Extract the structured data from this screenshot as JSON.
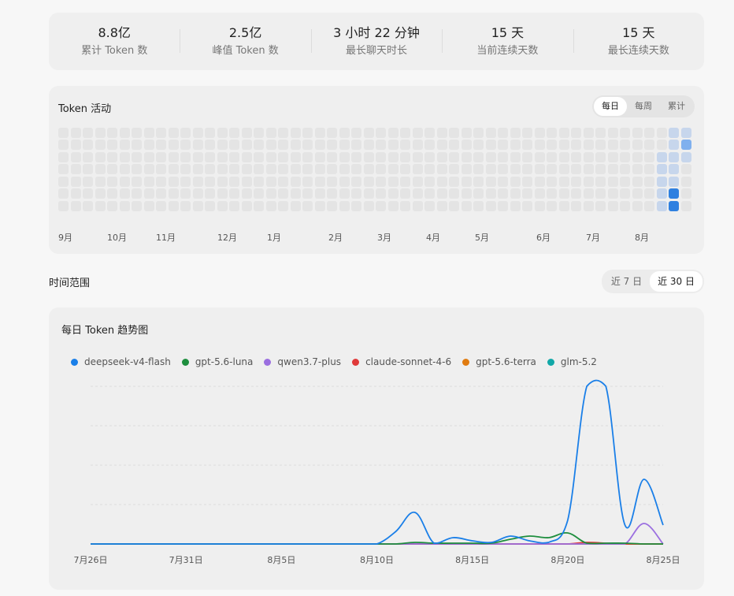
{
  "stats": [
    {
      "value": "8.8亿",
      "label": "累计 Token 数"
    },
    {
      "value": "2.5亿",
      "label": "峰值 Token 数"
    },
    {
      "value": "3 小时 22 分钟",
      "label": "最长聊天时长"
    },
    {
      "value": "15 天",
      "label": "当前连续天数"
    },
    {
      "value": "15 天",
      "label": "最长连续天数"
    }
  ],
  "activity": {
    "title": "Token 活动",
    "tabs": [
      "每日",
      "每周",
      "累计"
    ],
    "active_tab": "每日",
    "months": [
      "9月",
      "10月",
      "11月",
      "12月",
      "1月",
      "2月",
      "3月",
      "4月",
      "5月",
      "6月",
      "7月",
      "8月"
    ],
    "heat_colors": {
      "empty": "#e4e4e4",
      "l1": "#c7d6ec",
      "l2": "#a8c7ee",
      "l3": "#7fb0ee",
      "l4": "#2f80e0"
    },
    "recent_cells": [
      {
        "week_from_end": 1,
        "day": 0,
        "level": 1
      },
      {
        "week_from_end": 1,
        "day": 1,
        "level": 1
      },
      {
        "week_from_end": 1,
        "day": 2,
        "level": 1
      },
      {
        "week_from_end": 1,
        "day": 3,
        "level": 1
      },
      {
        "week_from_end": 1,
        "day": 4,
        "level": 1
      },
      {
        "week_from_end": 1,
        "day": 5,
        "level": 4
      },
      {
        "week_from_end": 1,
        "day": 6,
        "level": 4
      },
      {
        "week_from_end": 0,
        "day": 0,
        "level": 1
      },
      {
        "week_from_end": 0,
        "day": 1,
        "level": 3
      },
      {
        "week_from_end": 0,
        "day": 2,
        "level": 1
      },
      {
        "week_from_end": 2,
        "day": 2,
        "level": 1
      },
      {
        "week_from_end": 2,
        "day": 3,
        "level": 1
      },
      {
        "week_from_end": 2,
        "day": 4,
        "level": 1
      },
      {
        "week_from_end": 2,
        "day": 5,
        "level": 1
      },
      {
        "week_from_end": 2,
        "day": 6,
        "level": 1
      }
    ]
  },
  "range": {
    "label": "时间范围",
    "options": [
      "近 7 日",
      "近 30 日"
    ],
    "active": "近 30 日"
  },
  "trend": {
    "title": "每日 Token 趋势图"
  },
  "chart_data": {
    "type": "line",
    "x": [
      "7月26日",
      "7月27日",
      "7月28日",
      "7月29日",
      "7月30日",
      "7月31日",
      "8月1日",
      "8月2日",
      "8月3日",
      "8月4日",
      "8月5日",
      "8月6日",
      "8月7日",
      "8月8日",
      "8月9日",
      "8月10日",
      "8月11日",
      "8月12日",
      "8月13日",
      "8月14日",
      "8月15日",
      "8月16日",
      "8月17日",
      "8月18日",
      "8月19日",
      "8月20日",
      "8月21日",
      "8月22日",
      "8月23日",
      "8月24日",
      "8月25日"
    ],
    "x_ticks": [
      "7月26日",
      "7月31日",
      "8月5日",
      "8月10日",
      "8月15日",
      "8月20日",
      "8月25日"
    ],
    "ylim": [
      0,
      1
    ],
    "grid": true,
    "legend": "top-left",
    "series": [
      {
        "name": "deepseek-v4-flash",
        "color": "#1a7fe8",
        "values": [
          0,
          0,
          0,
          0,
          0,
          0,
          0,
          0,
          0,
          0,
          0,
          0,
          0,
          0,
          0,
          0,
          0.08,
          0.2,
          0.005,
          0.04,
          0.02,
          0.01,
          0.05,
          0.02,
          0.01,
          0.15,
          1.0,
          1.0,
          0.12,
          0.41,
          0.12
        ]
      },
      {
        "name": "gpt-5.6-luna",
        "color": "#1e8e3e",
        "values": [
          0,
          0,
          0,
          0,
          0,
          0,
          0,
          0,
          0,
          0,
          0,
          0,
          0,
          0,
          0,
          0,
          0,
          0.01,
          0.005,
          0.005,
          0.005,
          0.005,
          0.03,
          0.05,
          0.04,
          0.07,
          0.005,
          0.005,
          0.005,
          0,
          0
        ]
      },
      {
        "name": "qwen3.7-plus",
        "color": "#9b6fe0",
        "values": [
          0,
          0,
          0,
          0,
          0,
          0,
          0,
          0,
          0,
          0,
          0,
          0,
          0,
          0,
          0,
          0,
          0,
          0,
          0,
          0,
          0,
          0,
          0,
          0,
          0,
          0,
          0,
          0,
          0,
          0.13,
          0
        ]
      },
      {
        "name": "claude-sonnet-4-6",
        "color": "#e03a3a",
        "values": [
          0,
          0,
          0,
          0,
          0,
          0,
          0,
          0,
          0,
          0,
          0,
          0,
          0,
          0,
          0,
          0,
          0,
          0,
          0,
          0,
          0,
          0,
          0,
          0,
          0,
          0,
          0.01,
          0.005,
          0,
          0,
          0
        ]
      },
      {
        "name": "gpt-5.6-terra",
        "color": "#e07b10",
        "values": [
          0,
          0,
          0,
          0,
          0,
          0,
          0,
          0,
          0,
          0,
          0,
          0,
          0,
          0,
          0,
          0,
          0,
          0,
          0,
          0,
          0,
          0,
          0,
          0,
          0,
          0,
          0,
          0,
          0,
          0,
          0
        ]
      },
      {
        "name": "glm-5.2",
        "color": "#12a8a8",
        "values": [
          0,
          0,
          0,
          0,
          0,
          0,
          0,
          0,
          0,
          0,
          0,
          0,
          0,
          0,
          0,
          0,
          0,
          0,
          0,
          0,
          0,
          0,
          0,
          0,
          0,
          0,
          0,
          0,
          0,
          0,
          0
        ]
      }
    ]
  }
}
